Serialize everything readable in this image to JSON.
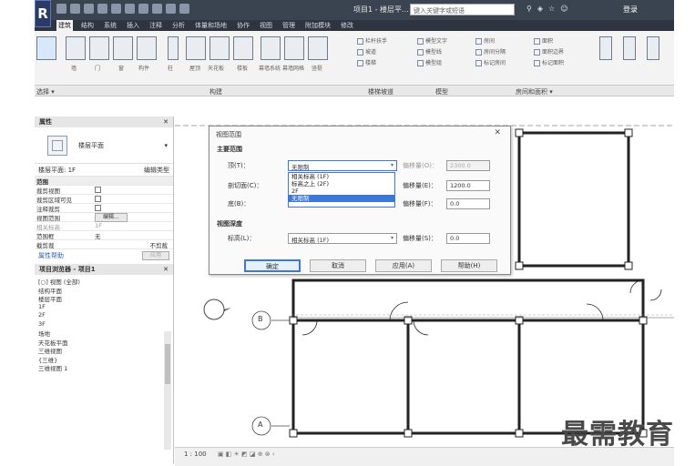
{
  "titlebar": {
    "title": "项目1 - 楼层平...",
    "search_placeholder": "键入关键字或短语",
    "signin": "登录"
  },
  "tabs": [
    "建筑",
    "结构",
    "系统",
    "插入",
    "注释",
    "分析",
    "体量和场地",
    "协作",
    "视图",
    "管理",
    "附加模块",
    "修改"
  ],
  "ribbon": {
    "big_buttons": [
      "墙",
      "门",
      "窗",
      "构件",
      "柱",
      "屋顶",
      "天花板",
      "楼板",
      "幕墙系统",
      "幕墙网格",
      "竖梃"
    ],
    "small_buttons": [
      [
        "栏杆扶手",
        "坡道",
        "楼梯"
      ],
      [
        "模型文字",
        "模型线",
        "模型组"
      ],
      [
        "房间",
        "房间分隔",
        "标记房间"
      ],
      [
        "面积",
        "面积边界",
        "标记面积"
      ]
    ],
    "panels": [
      "选择 ▾",
      "构建",
      "楼梯坡道",
      "模型",
      "房间和面积 ▾"
    ]
  },
  "properties": {
    "title": "属性",
    "type_name": "楼层平面",
    "filter": "楼层平面: 1F",
    "edit_type": "编辑类型",
    "section": "范围",
    "rows": [
      {
        "k": "裁剪视图",
        "v": "cb"
      },
      {
        "k": "裁剪区域可见",
        "v": "cb"
      },
      {
        "k": "注释裁剪",
        "v": "cb"
      },
      {
        "k": "视图范围",
        "v": "编辑..."
      },
      {
        "k": "相关标高",
        "v": "1F"
      },
      {
        "k": "范围框",
        "v": "无"
      },
      {
        "k": "截剪裁",
        "v": "不剪裁"
      }
    ],
    "help": "属性帮助",
    "apply": "应用"
  },
  "browser": {
    "title": "项目浏览器 - 项目1",
    "tree": [
      "[○] 视图 (全部)",
      "    结构平面",
      "    楼层平面",
      "      1F",
      "      2F",
      "      3F",
      "      场地",
      "    天花板平面",
      "    三维视图",
      "      {三维}",
      "      三维视图 1"
    ]
  },
  "dialog": {
    "title": "视图范围",
    "main_range": "主要范围",
    "top_label": "顶(T)：",
    "top_value": "无限制",
    "top_offset_label": "偏移量(O)：",
    "top_offset": "2300.0",
    "cut_label": "剖切面(C)：",
    "cut_value": "相关标高 (1F)",
    "cut_offset_label": "偏移量(E)：",
    "cut_offset": "1200.0",
    "bottom_label": "底(B)：",
    "bottom_value": "相关标高 (1F)",
    "bottom_offset_label": "偏移量(F)：",
    "bottom_offset": "0.0",
    "depth": "视图深度",
    "level_label": "标高(L)：",
    "level_value": "相关标高 (1F)",
    "level_offset_label": "偏移量(S)：",
    "level_offset": "0.0",
    "options": [
      "相关标高 (1F)",
      "标高之上 (2F)",
      "2F",
      "无限制"
    ],
    "selected_option": "无限制",
    "ok": "确定",
    "cancel": "取消",
    "apply": "应用(A)",
    "help": "帮助(H)"
  },
  "status": {
    "scale": "1 : 100"
  },
  "grid": {
    "b": "B",
    "a": "A"
  },
  "watermark": "最需教育"
}
